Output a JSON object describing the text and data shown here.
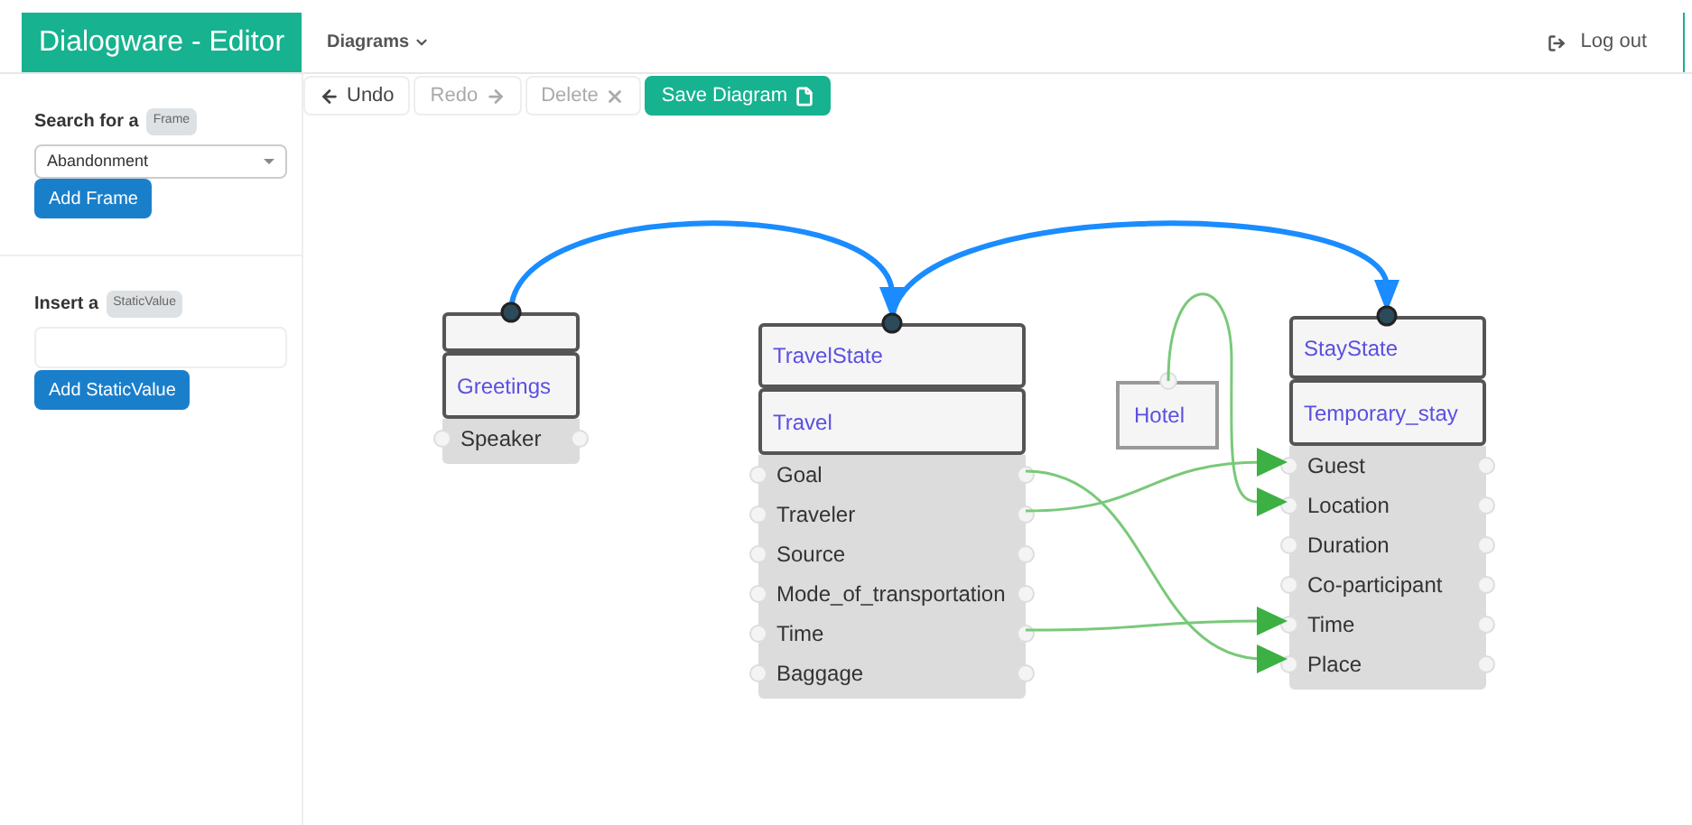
{
  "brand": "Dialogware - Editor",
  "nav": {
    "menu": "Diagrams",
    "logout": "Log out"
  },
  "toolbar": [
    {
      "label": "Undo",
      "disabled": false,
      "primary": false
    },
    {
      "label": "Redo",
      "disabled": true,
      "primary": false
    },
    {
      "label": "Delete",
      "disabled": true,
      "primary": false
    },
    {
      "label": "Save Diagram",
      "disabled": false,
      "primary": true
    }
  ],
  "sidebar": {
    "search": {
      "label": "Search for a",
      "badge": "Frame",
      "value": "Abandonment",
      "button": "Add Frame"
    },
    "insert": {
      "label": "Insert a",
      "badge": "StaticValue",
      "button": "Add StaticValue"
    }
  },
  "nodes": [
    {
      "kind": "frame",
      "name": "Greetings",
      "slots": [
        "Speaker"
      ]
    },
    {
      "kind": "frame",
      "state": "TravelState",
      "name": "Travel",
      "slots": [
        "Goal",
        "Traveler",
        "Source",
        "Mode_of_transportation",
        "Time",
        "Baggage"
      ]
    },
    {
      "kind": "value",
      "name": "Hotel"
    },
    {
      "kind": "frame",
      "state": "StayState",
      "name": "Temporary_stay",
      "slots": [
        "Guest",
        "Location",
        "Duration",
        "Co-participant",
        "Time",
        "Place"
      ]
    }
  ]
}
